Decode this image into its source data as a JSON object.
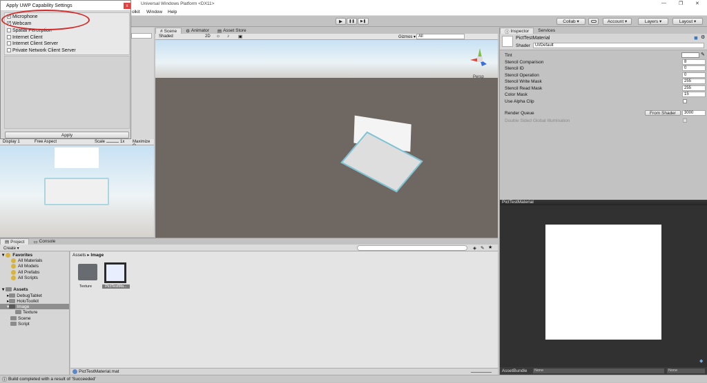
{
  "titlebar": {
    "title": "Universal Windows Platform <DX11>",
    "controls": [
      "—",
      "❐",
      "✕"
    ]
  },
  "menubar": {
    "items": [
      "olkit",
      "Window",
      "Help"
    ]
  },
  "toolbar": {
    "play": "▶",
    "pause": "❚❚",
    "step": "▶❚",
    "collab": "Collab ▾",
    "account": "Account ▾",
    "layers": "Layers ▾",
    "layout": "Layout ▾"
  },
  "dialog": {
    "title": "Apply UWP Capability Settings",
    "close": "x",
    "capabilities": [
      {
        "label": "Microphone",
        "checked": true
      },
      {
        "label": "Webcam",
        "checked": true
      },
      {
        "label": "Spatial Perception",
        "checked": false
      },
      {
        "label": "Internet Client",
        "checked": false
      },
      {
        "label": "Internet Client Server",
        "checked": false
      },
      {
        "label": "Private Network Client Server",
        "checked": false
      }
    ],
    "apply": "Apply"
  },
  "game": {
    "display": "Display 1",
    "aspect": "Free Aspect",
    "scale_label": "Scale",
    "scale_value": "1x",
    "maximize": "Maximize O"
  },
  "scene": {
    "tabs": [
      "Scene",
      "Animator",
      "Asset Store"
    ],
    "shading": "Shaded",
    "mode2d": "2D",
    "gizmos": "Gizmos ▾",
    "search": "All",
    "persp": "Persp"
  },
  "inspector": {
    "tabs": [
      "Inspector",
      "Services"
    ],
    "material_name": "PictTestMaterial",
    "shader_label": "Shader",
    "shader_value": "UI/Default",
    "properties": [
      {
        "label": "Tint",
        "value": ""
      },
      {
        "label": "Stencil Comparison",
        "value": "8"
      },
      {
        "label": "Stencil ID",
        "value": "0"
      },
      {
        "label": "Stencil Operation",
        "value": "0"
      },
      {
        "label": "Stencil Write Mask",
        "value": "255"
      },
      {
        "label": "Stencil Read Mask",
        "value": "255"
      },
      {
        "label": "Color Mask",
        "value": "15"
      },
      {
        "label": "Use Alpha Clip",
        "value": ""
      }
    ],
    "render_queue_label": "Render Queue",
    "render_queue_mode": "From Shader",
    "render_queue_value": "3000",
    "double_sided": "Double Sided Global Illumination",
    "preview_title": "PictTestMaterial",
    "assetbundle_label": "AssetBundle",
    "assetbundle_value": "None",
    "assetbundle_variant": "None"
  },
  "project": {
    "tabs": [
      "Project",
      "Console"
    ],
    "create": "Create ▾",
    "favorites_title": "Favorites",
    "favorites": [
      "All Materials",
      "All Models",
      "All Prefabs",
      "All Scripts"
    ],
    "assets_title": "Assets",
    "tree": [
      "DebugTablet",
      "HoloToolkit",
      "Image",
      "Texture",
      "Scene",
      "Script"
    ],
    "breadcrumb_root": "Assets",
    "breadcrumb_sep": "▸",
    "breadcrumb_current": "Image",
    "items": [
      "Texture",
      "PictTestMa..."
    ],
    "selected_file": "PictTestMaterial.mat"
  },
  "status": {
    "message": "Build completed with a result of 'Succeeded'"
  },
  "colors": {
    "annotation": "#d42a2a",
    "sky": "#c7e1f3",
    "ground": "#6f6862",
    "selection": "#3d78c8"
  }
}
